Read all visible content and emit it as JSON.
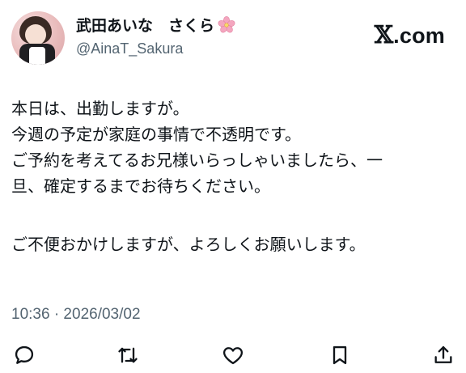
{
  "author": {
    "display_name": "武田あいな　さくら",
    "handle": "@AinaT_Sakura",
    "name_emoji": "cherry-blossom-icon"
  },
  "brand": {
    "x_letter": "𝕏",
    "suffix": ".com"
  },
  "post": {
    "lines": [
      "本日は、出勤しますが。",
      "今週の予定が家庭の事情で不透明です。",
      "ご予約を考えてるお兄様いらっしゃいましたら、一",
      "旦、確定するまでお待ちください。",
      "",
      "ご不便おかけしますが、よろしくお願いします。"
    ]
  },
  "meta": {
    "timestamp": "10:36 · 2026/03/02"
  },
  "actions": [
    {
      "icon": "reply-icon"
    },
    {
      "icon": "repost-icon"
    },
    {
      "icon": "like-icon"
    },
    {
      "icon": "bookmark-icon"
    },
    {
      "icon": "share-icon"
    }
  ],
  "colors": {
    "text": "#0f1419",
    "secondary": "#536471",
    "background": "#ffffff"
  }
}
